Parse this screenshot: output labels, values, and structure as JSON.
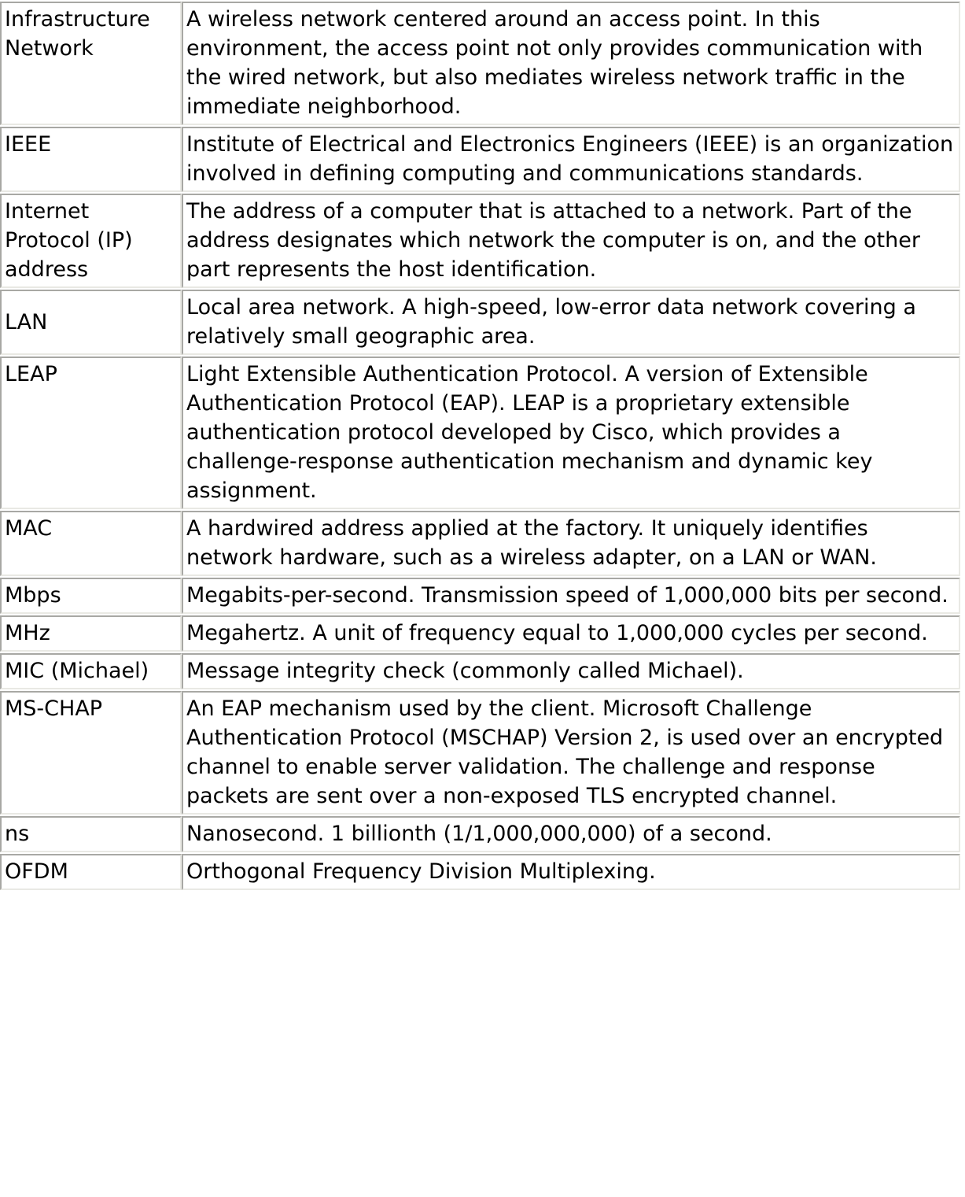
{
  "document": {
    "type": "glossary-table",
    "columns": 2,
    "style": {
      "border_color_dark": "#a8a8a4",
      "border_color_light": "#e9e9e4",
      "background": "#ffffff",
      "text_color": "#000000"
    },
    "rows": [
      {
        "term": "Infrastructure Network",
        "definition": "A wireless network centered around an access point. In this environment, the access point not only provides communication with the wired network, but also mediates wireless network traffic in the immediate neighborhood.",
        "term_valign": "top",
        "def_valign": "top"
      },
      {
        "term": "IEEE",
        "definition": "Institute of Electrical and Electronics Engineers (IEEE) is an organization involved in defining computing and communications standards.",
        "term_valign": "top",
        "def_valign": "top"
      },
      {
        "term": "Internet Protocol (IP) address",
        "definition": "The address of a computer that is attached to a network. Part of the address designates which network the computer is on, and the other part represents the host identification.",
        "term_valign": "top",
        "def_valign": "top"
      },
      {
        "term": "LAN",
        "definition": "Local area network. A high-speed, low-error data network covering a relatively small geographic area.",
        "term_valign": "middle",
        "def_valign": "top"
      },
      {
        "term": "LEAP",
        "definition": "Light Extensible Authentication Protocol. A version of Extensible Authentication Protocol (EAP). LEAP is a proprietary extensible authentication protocol developed by Cisco, which provides a challenge-response authentication mechanism and dynamic key assignment.",
        "term_valign": "top",
        "def_valign": "top"
      },
      {
        "term": "MAC",
        "definition": "A hardwired address applied at the factory. It uniquely identifies network hardware, such as a wireless adapter, on a LAN or WAN.",
        "term_valign": "top",
        "def_valign": "top"
      },
      {
        "term": "Mbps",
        "definition": "Megabits-per-second. Transmission speed of 1,000,000 bits per second.",
        "term_valign": "middle",
        "def_valign": "top"
      },
      {
        "term": "MHz",
        "definition": "Megahertz. A unit of frequency equal to 1,000,000 cycles per second.",
        "term_valign": "middle",
        "def_valign": "top"
      },
      {
        "term": "MIC (Michael)",
        "definition": "Message integrity check (commonly called Michael).",
        "term_valign": "middle",
        "def_valign": "middle"
      },
      {
        "term": "MS-CHAP",
        "definition": "An EAP mechanism used by the client. Microsoft Challenge Authentication Protocol (MSCHAP) Version 2, is used over an encrypted channel to enable server validation. The challenge and response packets are sent over a non-exposed TLS encrypted channel.",
        "term_valign": "top",
        "def_valign": "top"
      },
      {
        "term": "ns",
        "definition": "Nanosecond. 1 billionth (1/1,000,000,000) of a second.",
        "term_valign": "middle",
        "def_valign": "middle"
      },
      {
        "term": "OFDM",
        "definition": "Orthogonal Frequency Division Multiplexing.",
        "term_valign": "middle",
        "def_valign": "middle"
      }
    ]
  }
}
